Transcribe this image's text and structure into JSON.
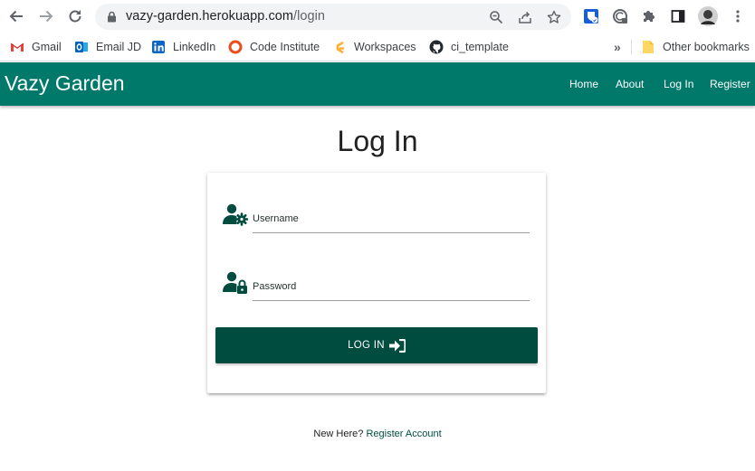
{
  "browser": {
    "url_domain": "vazy-garden.herokuapp.com",
    "url_path": "/login",
    "bookmarks": [
      {
        "label": "Gmail",
        "icon": "gmail-icon"
      },
      {
        "label": "Email JD",
        "icon": "outlook-icon"
      },
      {
        "label": "LinkedIn",
        "icon": "linkedin-icon"
      },
      {
        "label": "Code Institute",
        "icon": "code-institute-icon"
      },
      {
        "label": "Workspaces",
        "icon": "gitpod-icon"
      },
      {
        "label": "ci_template",
        "icon": "github-icon"
      }
    ],
    "overflow_label": "»",
    "other_bookmarks_label": "Other bookmarks"
  },
  "site": {
    "brand": "Vazy Garden",
    "nav": [
      {
        "label": "Home"
      },
      {
        "label": "About"
      },
      {
        "label": "Log In"
      },
      {
        "label": "Register"
      }
    ],
    "colors": {
      "navbar": "#00796b",
      "button": "#004d40",
      "icon": "#004d40"
    }
  },
  "login": {
    "title": "Log In",
    "username_label": "Username",
    "password_label": "Password",
    "submit_label": "LOG IN",
    "register_prompt": "New Here?",
    "register_link": "Register Account"
  }
}
